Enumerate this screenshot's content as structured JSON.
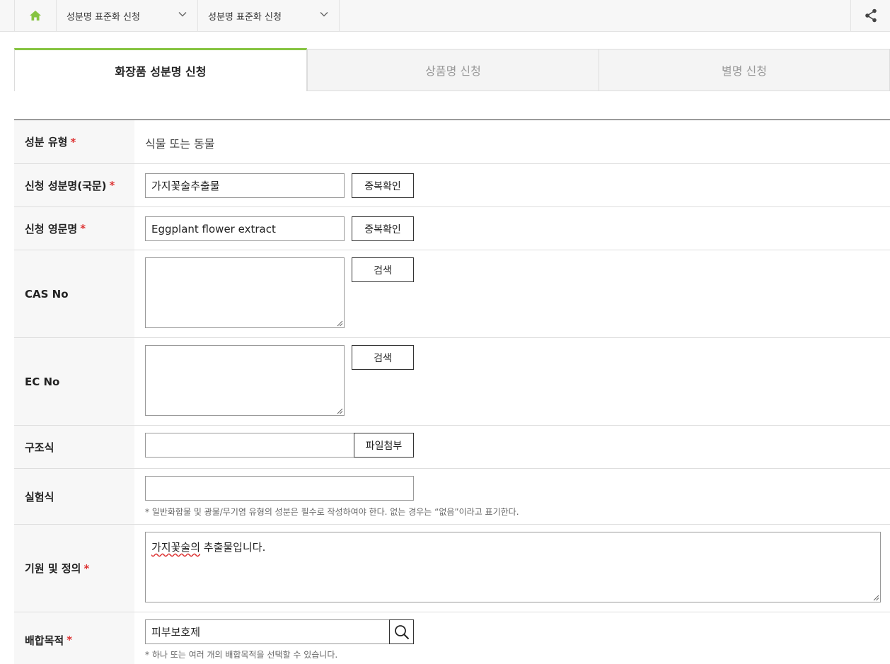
{
  "breadcrumb": {
    "items": [
      {
        "label": "성분명 표준화 신청"
      },
      {
        "label": "성분명 표준화 신청"
      }
    ]
  },
  "tabs": [
    {
      "label": "화장품 성분명 신청",
      "active": true
    },
    {
      "label": "상품명 신청",
      "active": false
    },
    {
      "label": "별명 신청",
      "active": false
    }
  ],
  "form": {
    "ingredient_type": {
      "label": "성분 유형",
      "required_mark": "*",
      "value": "식물 또는 동물"
    },
    "korean_name": {
      "label": "신청 성분명(국문)",
      "required_mark": "*",
      "value": "가지꽃술추출물",
      "button": "중복확인"
    },
    "english_name": {
      "label": "신청 영문명",
      "required_mark": "*",
      "value": "Eggplant flower extract",
      "button": "중복확인"
    },
    "cas_no": {
      "label": "CAS No",
      "value": "",
      "button": "검색"
    },
    "ec_no": {
      "label": "EC No",
      "value": "",
      "button": "검색"
    },
    "structure": {
      "label": "구조식",
      "value": "",
      "button": "파일첨부"
    },
    "formula": {
      "label": "실험식",
      "value": "",
      "note": "* 일반화합물 및 광물/무기염 유형의 성분은 필수로 작성하여야 한다. 없는 경우는 “없음”이라고 표기한다."
    },
    "origin": {
      "label": "기원 및 정의",
      "required_mark": "*",
      "value_underlined": "가지꽃술의",
      "value_rest": " 추출물입니다."
    },
    "purpose": {
      "label": "배합목적",
      "required_mark": "*",
      "value": "피부보호제",
      "note": "* 하나 또는 여러 개의 배합목적을 선택할 수 있습니다."
    }
  },
  "colors": {
    "accent": "#86c441",
    "required": "#dd3333",
    "label_bg": "#f7f7f7"
  },
  "icons": {
    "home": "home-icon",
    "chevron": "chevron-down-icon",
    "share": "share-icon",
    "search": "search-icon"
  }
}
